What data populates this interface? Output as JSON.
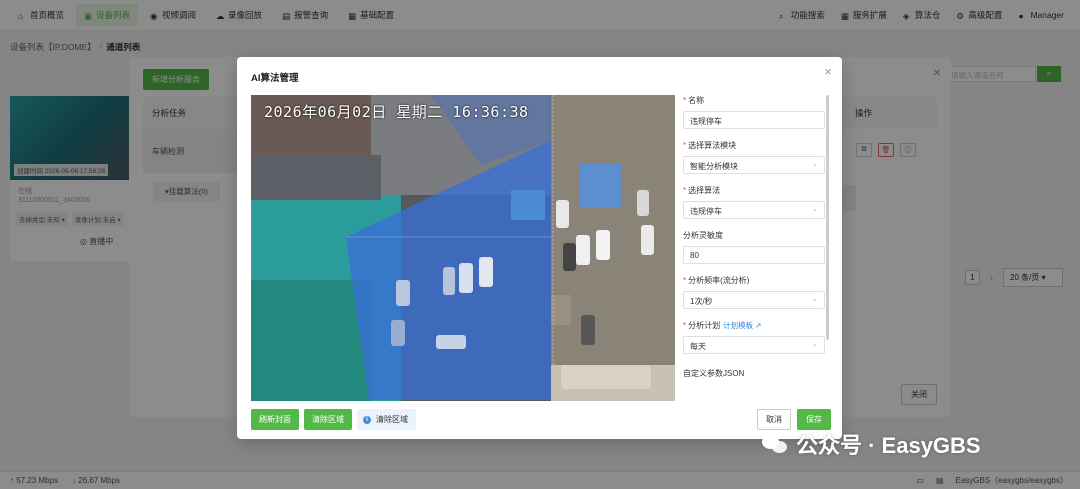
{
  "nav": {
    "items": [
      {
        "label": "首页概览",
        "icon": "home-icon"
      },
      {
        "label": "设备列表",
        "icon": "device-icon",
        "active": true
      },
      {
        "label": "视频调阅",
        "icon": "video-icon"
      },
      {
        "label": "录像回放",
        "icon": "cloud-icon"
      },
      {
        "label": "报警查询",
        "icon": "bell-icon"
      },
      {
        "label": "基础配置",
        "icon": "config-icon"
      }
    ],
    "right": [
      {
        "label": "功能搜索",
        "icon": "search-icon"
      },
      {
        "label": "服务扩展",
        "icon": "grid-icon"
      },
      {
        "label": "算法仓",
        "icon": "box-icon"
      },
      {
        "label": "高级配置",
        "icon": "gear-icon"
      },
      {
        "label": "Manager",
        "icon": "user-icon"
      }
    ]
  },
  "breadcrumb": {
    "parent": "设备列表【IP.DOME】",
    "sep": "/",
    "current": "通道列表"
  },
  "device_card": {
    "time": "创建时间 2026-05-06 17:58:28",
    "name": "在线",
    "id": "31110000011_3402000",
    "tag1": "去掉类型:未知 ▾",
    "tag2": "录像计划:未启 ▾",
    "live": "◎ 直播中"
  },
  "back_modal": {
    "add_button": "新增分析服务",
    "col_task": "分析任务",
    "col_ops": "操作",
    "row_task": "车辆检测",
    "mount": "▾挂载算法(0)",
    "partial": "操作",
    "close_button": "关闭"
  },
  "search": {
    "placeholder": "请输入通道名称"
  },
  "pager": {
    "page": "1",
    "next": "›",
    "size": "20 条/页 ▾"
  },
  "status": {
    "up": "↑ 57.23 Mbps",
    "down": "↓ 26.67 Mbps",
    "brand": "EasyGBS（easygbs/easygbs）"
  },
  "dialog": {
    "title": "AI算法管理",
    "close": "×",
    "osd": "2026年06月02日 星期二 16:36:38",
    "actions": {
      "refresh": "刷新封面",
      "clear": "清除区域",
      "hint": "清除区域"
    },
    "form": {
      "name_label": "名称",
      "name_value": "违规停车",
      "module_label": "选择算法模块",
      "module_value": "智能分析模块",
      "algo_label": "选择算法",
      "algo_value": "违规停车",
      "sens_label": "分析灵敏度",
      "sens_value": "80",
      "freq_label": "分析频率(流分析)",
      "freq_value": "1次/秒",
      "plan_label": "分析计划",
      "plan_link": "计划模板",
      "plan_value": "每天",
      "json_label": "自定义参数JSON"
    },
    "cancel": "取消",
    "save": "保存"
  },
  "watermark": "公众号 · EasyGBS",
  "colors": {
    "accent": "#52b848",
    "region": "#3a6fd6",
    "link": "#2b8ae0"
  }
}
